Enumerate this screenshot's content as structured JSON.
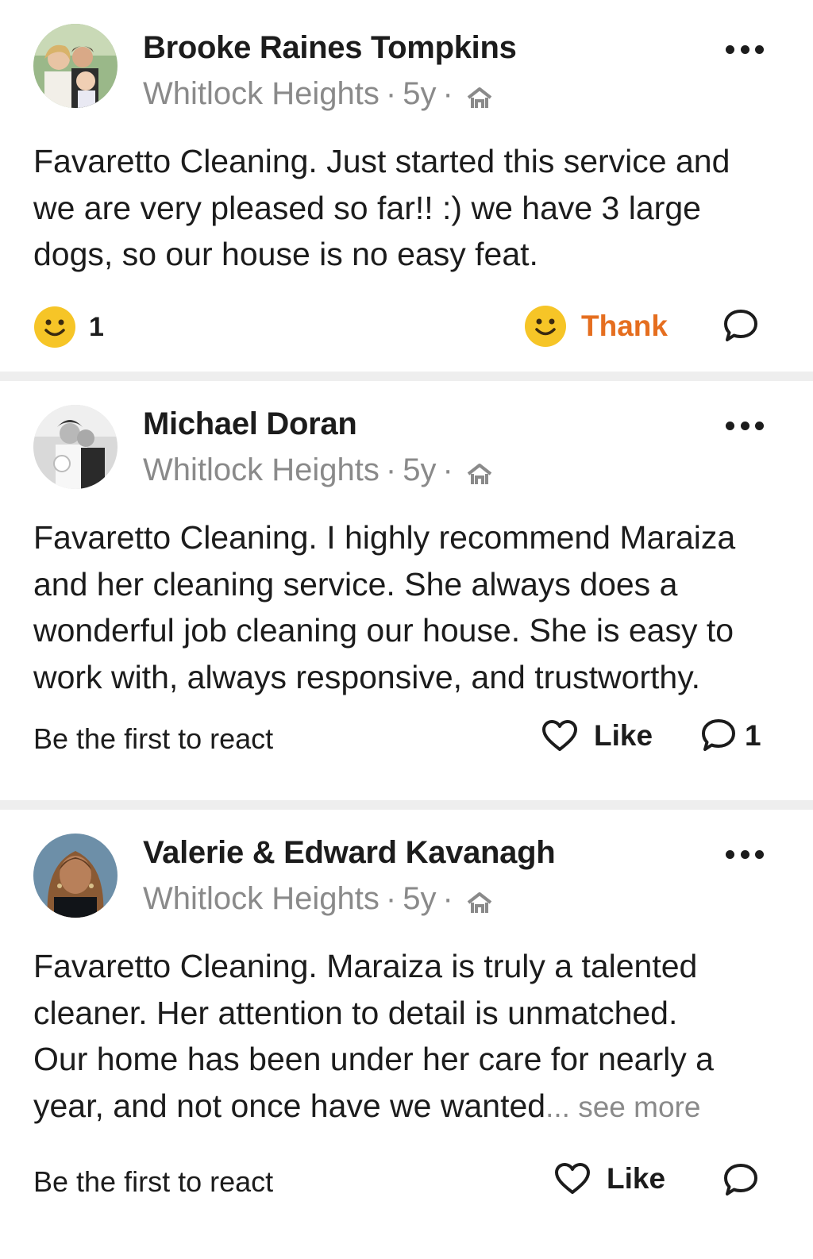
{
  "posts": [
    {
      "author": "Brooke Raines Tompkins",
      "neighborhood": "Whitlock Heights",
      "dot1": "·",
      "age": "5y",
      "dot2": "·",
      "text": "Favaretto Cleaning. Just started this service and\nwe are very pleased so far!! :) we have 3 large\ndogs, so our house is no easy feat.",
      "reaction_count": "1",
      "action_label": "Thank",
      "comment_count": ""
    },
    {
      "author": "Michael Doran",
      "neighborhood": "Whitlock Heights",
      "dot1": "·",
      "age": "5y",
      "dot2": "·",
      "text": "Favaretto Cleaning. I highly recommend Maraiza\nand her cleaning service. She always does a\nwonderful job cleaning our house. She is easy to\nwork with, always responsive, and trustworthy.",
      "reaction_prompt": "Be the first to react",
      "action_label": "Like",
      "comment_count": "1"
    },
    {
      "author": "Valerie & Edward Kavanagh",
      "neighborhood": "Whitlock Heights",
      "dot1": "·",
      "age": "5y",
      "dot2": "·",
      "text": "Favaretto Cleaning. Maraiza is truly a talented\ncleaner. Her  attention to detail is unmatched.\nOur home has been under her care for nearly a\nyear,  and not once have we wanted",
      "see_more": "... see more",
      "reaction_prompt": "Be the first to react",
      "action_label": "Like",
      "comment_count": ""
    }
  ],
  "colors": {
    "thank": "#e56e1f",
    "muted": "#8a8a8a",
    "emoji": "#f6c527",
    "separator": "#eeeeee"
  }
}
